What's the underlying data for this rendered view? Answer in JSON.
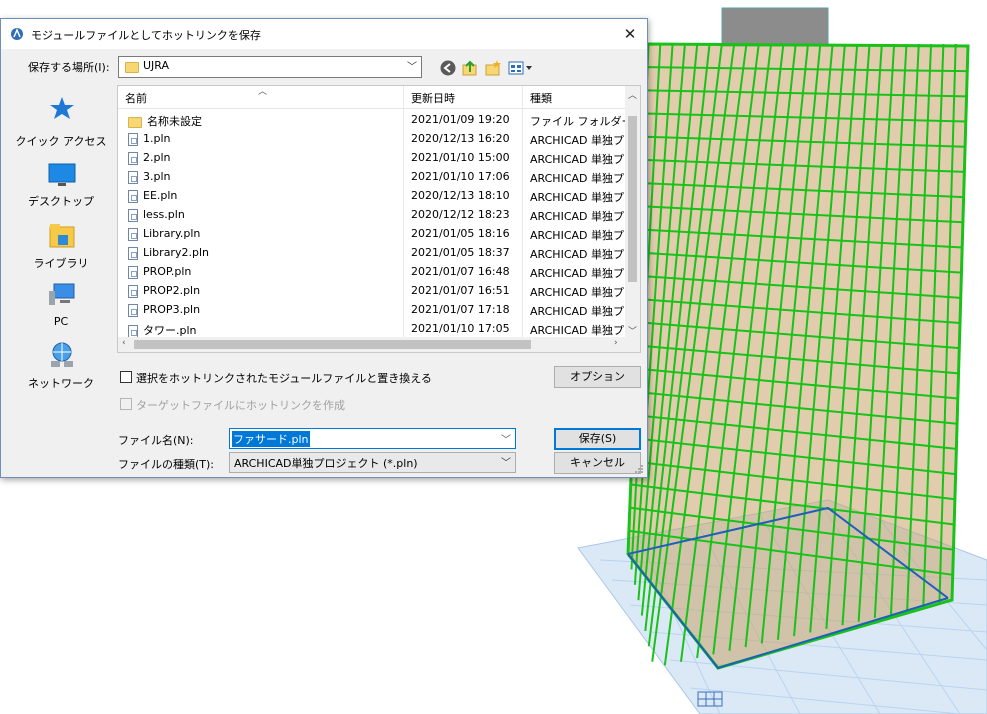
{
  "dialog": {
    "title": "モジュールファイルとしてホットリンクを保存",
    "close_glyph": "✕",
    "save_in_label": "保存する場所(I):",
    "save_in_value": "UJRA",
    "places": [
      {
        "label": "クイック アクセス",
        "icon": "quick-access-star-icon"
      },
      {
        "label": "デスクトップ",
        "icon": "desktop-icon"
      },
      {
        "label": "ライブラリ",
        "icon": "library-icon"
      },
      {
        "label": "PC",
        "icon": "pc-icon"
      },
      {
        "label": "ネットワーク",
        "icon": "network-icon"
      }
    ],
    "columns": {
      "name": "名前",
      "date": "更新日時",
      "type": "種類"
    },
    "files": [
      {
        "name": "名称未設定",
        "date": "2021/01/09 19:20",
        "type": "ファイル フォルダー",
        "icon": "folder"
      },
      {
        "name": "1.pln",
        "date": "2020/12/13 16:20",
        "type": "ARCHICAD 単独プ...",
        "icon": "doc"
      },
      {
        "name": "2.pln",
        "date": "2021/01/10 15:00",
        "type": "ARCHICAD 単独プ...",
        "icon": "doc"
      },
      {
        "name": "3.pln",
        "date": "2021/01/10 17:06",
        "type": "ARCHICAD 単独プ...",
        "icon": "doc"
      },
      {
        "name": "EE.pln",
        "date": "2020/12/13 18:10",
        "type": "ARCHICAD 単独プ...",
        "icon": "doc"
      },
      {
        "name": "less.pln",
        "date": "2020/12/12 18:23",
        "type": "ARCHICAD 単独プ...",
        "icon": "doc"
      },
      {
        "name": "Library.pln",
        "date": "2021/01/05 18:16",
        "type": "ARCHICAD 単独プ...",
        "icon": "doc"
      },
      {
        "name": "Library2.pln",
        "date": "2021/01/05 18:37",
        "type": "ARCHICAD 単独プ...",
        "icon": "doc"
      },
      {
        "name": "PROP.pln",
        "date": "2021/01/07 16:48",
        "type": "ARCHICAD 単独プ...",
        "icon": "doc"
      },
      {
        "name": "PROP2.pln",
        "date": "2021/01/07 16:51",
        "type": "ARCHICAD 単独プ...",
        "icon": "doc"
      },
      {
        "name": "PROP3.pln",
        "date": "2021/01/07 17:18",
        "type": "ARCHICAD 単独プ...",
        "icon": "doc"
      },
      {
        "name": "タワー.pln",
        "date": "2021/01/10 17:05",
        "type": "ARCHICAD 単独プ...",
        "icon": "doc"
      }
    ],
    "replace_checkbox_label": "選択をホットリンクされたモジュールファイルと置き換える",
    "options_button": "オプション",
    "hotlink_checkbox_label": "ターゲットファイルにホットリンクを作成",
    "filename_label": "ファイル名(N):",
    "filename_value": "ファサード.pln",
    "filetype_label": "ファイルの種類(T):",
    "filetype_value": "ARCHICAD単独プロジェクト (*.pln)",
    "save_button": "保存(S)",
    "cancel_button": "キャンセル"
  },
  "colors": {
    "accent": "#0078d7",
    "tower_green": "#19c219",
    "tower_wood": "#c9a46a",
    "ground_grid": "#b9d4ef"
  }
}
